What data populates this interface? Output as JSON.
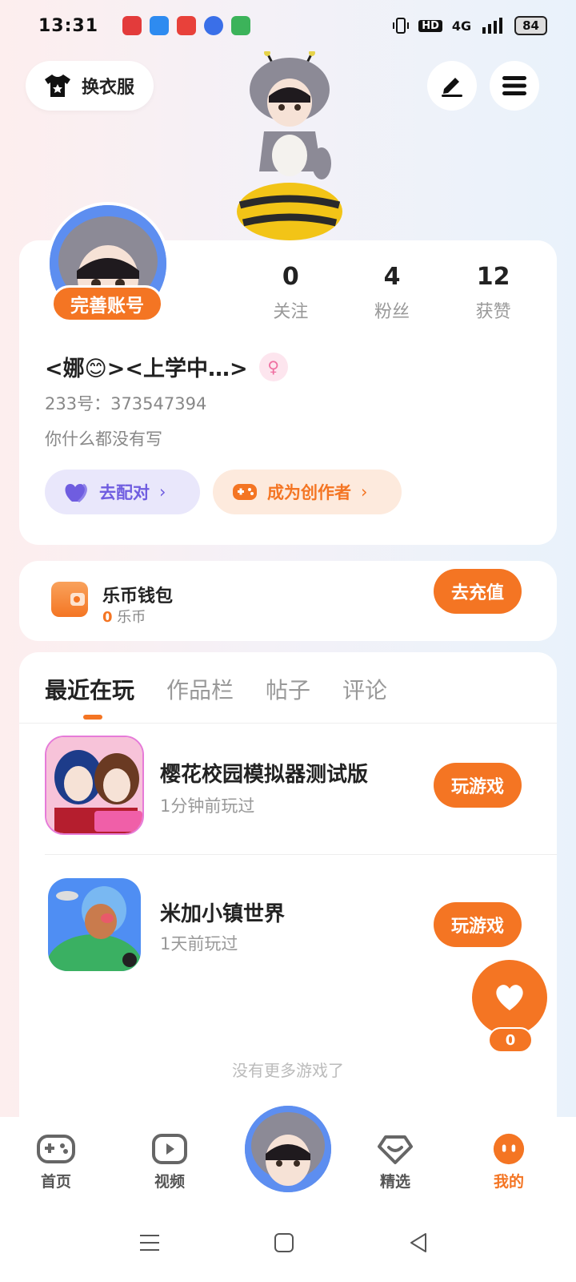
{
  "status_bar": {
    "time": "13:31",
    "network": "4G",
    "battery": "84",
    "app_icons": [
      "#e33b3b",
      "#2e8bf0",
      "#e8413a",
      "#3a6fe8",
      "#3cb35a"
    ]
  },
  "header": {
    "dress_up_label": "换衣服",
    "icons": [
      "shirt-icon",
      "edit-icon",
      "menu-icon"
    ]
  },
  "profile": {
    "complete_badge": "完善账号",
    "stats": [
      {
        "value": "0",
        "label": "关注"
      },
      {
        "value": "4",
        "label": "粉丝"
      },
      {
        "value": "12",
        "label": "获赞"
      }
    ],
    "username": "<娜😊><上学中…>",
    "gender": "female",
    "id_line": "233号：373547394",
    "bio": "你什么都没有写",
    "chips": {
      "match": "去配对",
      "creator": "成为创作者"
    }
  },
  "wallet": {
    "title": "乐币钱包",
    "balance_value": "0",
    "balance_unit": "乐币",
    "recharge_label": "去充值"
  },
  "tabs": [
    "最近在玩",
    "作品栏",
    "帖子",
    "评论"
  ],
  "active_tab": 0,
  "games": [
    {
      "title": "樱花校园模拟器测试版",
      "time": "1分钟前玩过",
      "button": "玩游戏"
    },
    {
      "title": "米加小镇世界",
      "time": "1天前玩过",
      "button": "玩游戏"
    }
  ],
  "no_more_text": "没有更多游戏了",
  "fab_count": "0",
  "bottom_nav": [
    {
      "label": "首页",
      "icon": "gamepad-icon"
    },
    {
      "label": "视频",
      "icon": "video-play-icon"
    },
    {
      "label": "精选",
      "icon": "heart-box-icon"
    },
    {
      "label": "我的",
      "icon": "me-face-icon",
      "active": true
    }
  ],
  "colors": {
    "accent": "#f47523",
    "match_purple": "#6f5de0"
  }
}
